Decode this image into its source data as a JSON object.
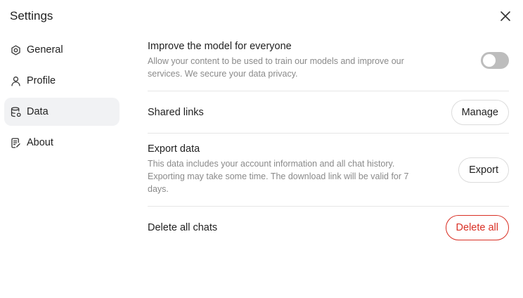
{
  "header": {
    "title": "Settings"
  },
  "sidebar": {
    "items": [
      {
        "label": "General",
        "icon": "gear-icon"
      },
      {
        "label": "Profile",
        "icon": "user-icon"
      },
      {
        "label": "Data",
        "icon": "database-icon",
        "active": true
      },
      {
        "label": "About",
        "icon": "document-icon"
      }
    ]
  },
  "settings": {
    "improve": {
      "title": "Improve the model for everyone",
      "description": "Allow your content to be used to train our models and improve our services. We secure your data privacy.",
      "toggle_on": false
    },
    "shared_links": {
      "title": "Shared links",
      "button": "Manage"
    },
    "export": {
      "title": "Export data",
      "description": "This data includes your account information and all chat history. Exporting may take some time. The download link will be valid for 7 days.",
      "button": "Export"
    },
    "delete": {
      "title": "Delete all chats",
      "button": "Delete all"
    }
  },
  "colors": {
    "danger": "#d93025",
    "toggle_off": "#bdbdbd",
    "active_nav_bg": "#f1f2f4"
  }
}
